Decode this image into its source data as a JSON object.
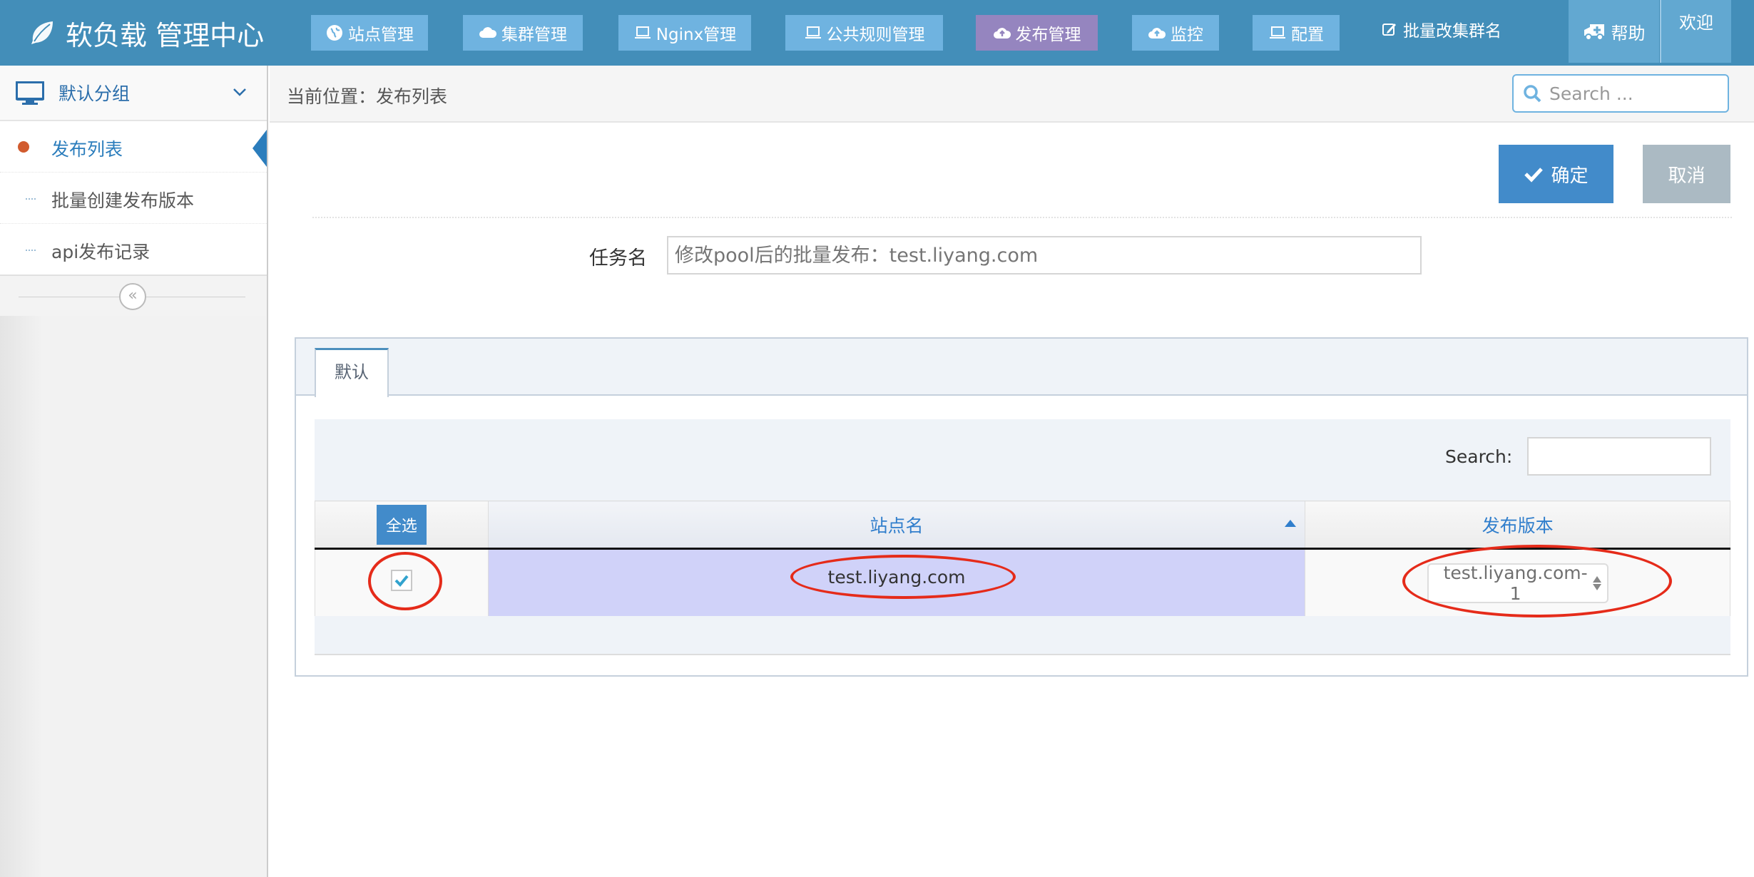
{
  "header": {
    "brand": "软负载 管理中心",
    "nav": [
      {
        "label": "站点管理",
        "icon": "globe-icon"
      },
      {
        "label": "集群管理",
        "icon": "cloud-icon"
      },
      {
        "label": "Nginx管理",
        "icon": "laptop-icon"
      },
      {
        "label": "公共规则管理",
        "icon": "laptop-icon"
      },
      {
        "label": "发布管理",
        "icon": "cloud-upload-icon",
        "active": true
      },
      {
        "label": "监控",
        "icon": "cloud-upload-icon"
      },
      {
        "label": "配置",
        "icon": "laptop-icon"
      },
      {
        "label": "批量改集群名",
        "icon": "edit-icon"
      }
    ],
    "help": "帮助",
    "welcome": "欢迎"
  },
  "sidebar": {
    "group": "默认分组",
    "items": [
      {
        "label": "发布列表",
        "active": true
      },
      {
        "label": "批量创建发布版本"
      },
      {
        "label": "api发布记录"
      }
    ],
    "collapse_glyph": "«"
  },
  "breadcrumb": {
    "text": "当前位置：发布列表"
  },
  "nav_search": {
    "placeholder": "Search ..."
  },
  "actions": {
    "confirm": "确定",
    "cancel": "取消"
  },
  "form": {
    "task_label": "任务名",
    "task_placeholder": "修改pool后的批量发布：test.liyang.com",
    "task_value": ""
  },
  "tabs": [
    {
      "label": "默认",
      "active": true
    }
  ],
  "table": {
    "search_label": "Search:",
    "search_value": "",
    "select_all": "全选",
    "columns": [
      "站点名",
      "发布版本"
    ],
    "sort": {
      "column": "站点名",
      "direction": "asc"
    },
    "rows": [
      {
        "checked": true,
        "site": "test.liyang.com",
        "version": "test.liyang.com-1"
      }
    ]
  },
  "colors": {
    "header_bg": "#438eb9",
    "nav_btn": "#6fb3e0",
    "nav_active": "#9585bf",
    "primary": "#428bca",
    "cancel": "#abbac3",
    "selected_row": "#d0d2f9",
    "annotation": "#e52b1a"
  }
}
